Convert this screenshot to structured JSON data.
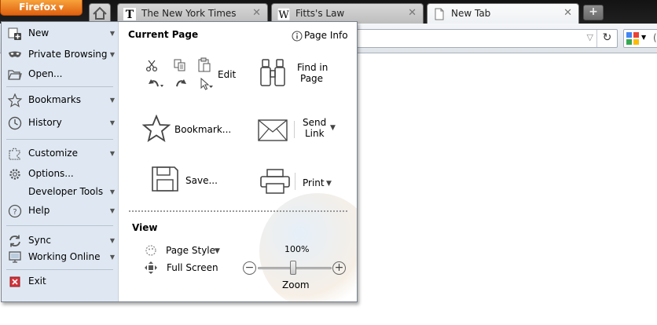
{
  "firefox_button": {
    "label": "Firefox",
    "caret": "▼"
  },
  "tabs": [
    {
      "title": "The New York Times",
      "icon": "nyt-favicon",
      "close": "✕"
    },
    {
      "title": "Fitts's Law",
      "icon": "wikipedia-favicon",
      "close": "✕"
    },
    {
      "title": "New Tab",
      "icon": "blank-page-favicon",
      "close": "✕"
    }
  ],
  "new_tab_button": "+",
  "urlbar": {
    "value": "",
    "dropdown": "▽",
    "reload": "↻"
  },
  "search_engine_partial": "(",
  "menu": {
    "left_items": [
      {
        "label": "New",
        "icon": "new-tab-plus-icon"
      },
      {
        "label": "Private Browsing",
        "icon": "mask-icon"
      },
      {
        "label": "Open...",
        "icon": "folder-icon"
      },
      {
        "label": "Bookmarks",
        "icon": "bookmark-star-icon"
      },
      {
        "label": "History",
        "icon": "clock-icon"
      },
      {
        "label": "Customize",
        "icon": "puzzle-icon"
      },
      {
        "label": "Options...",
        "icon": "gear-icon"
      },
      {
        "label": "Developer Tools",
        "icon": ""
      },
      {
        "label": "Help",
        "icon": "help-icon"
      },
      {
        "label": "Sync",
        "icon": "sync-icon"
      },
      {
        "label": "Working Online",
        "icon": "computer-icon"
      },
      {
        "label": "Exit",
        "icon": "exit-icon"
      }
    ],
    "current_page": {
      "title": "Current Page",
      "page_info": "Page Info",
      "edit": "Edit",
      "find_line1": "Find in",
      "find_line2": "Page",
      "bookmark": "Bookmark...",
      "send_line1": "Send",
      "send_line2": "Link",
      "save": "Save...",
      "print": "Print"
    },
    "view": {
      "title": "View",
      "page_style": "Page Style",
      "full_screen": "Full Screen",
      "zoom_value": "100%",
      "zoom_label": "Zoom"
    }
  },
  "colors": {
    "firefox_orange": "#e8731a",
    "menu_left_bg": "#dfe8f2",
    "exit_red": "#d8333a"
  }
}
